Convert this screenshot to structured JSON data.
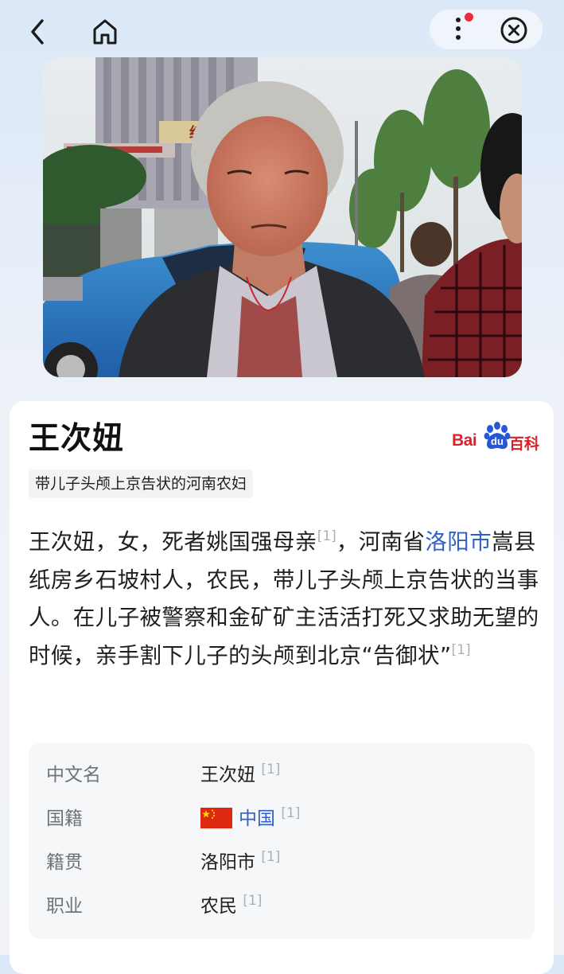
{
  "topbar": {
    "back_icon": "back-arrow-icon",
    "home_icon": "home-icon",
    "more_icon": "more-vertical-icon",
    "close_icon": "close-circle-icon",
    "notification_dot_color": "#f0283c"
  },
  "photo": {
    "description_icon": "portrait-photo",
    "sign_text": "红"
  },
  "entry": {
    "title": "王次妞",
    "tag": "带儿子头颅上京告状的河南农妇",
    "source_logo": {
      "bai": "Bai",
      "du": "du",
      "ke": "百科",
      "color": "#de1f28"
    },
    "summary": {
      "part1": "王次妞，女，死者姚国强母亲",
      "ref1": "[1]",
      "part2": "，河南省",
      "link": "洛阳市",
      "part3": "嵩县纸房乡石坡村人，农民，带儿子头颅上京告状的当事人。在儿子被警察和金矿矿主活活打死又求助无望的时候，亲手割下儿子的头颅到北京“告御状”",
      "ref2": "[1]"
    },
    "infobox": [
      {
        "label": "中文名",
        "value": "王次妞",
        "ref": "[1]"
      },
      {
        "label": "国籍",
        "value": "中国",
        "ref": "[1]",
        "flag": "china-flag-icon"
      },
      {
        "label": "籍贯",
        "value": "洛阳市",
        "ref": "[1]"
      },
      {
        "label": "职业",
        "value": "农民",
        "ref": "[1]"
      }
    ],
    "link_color": "#2f5fcb"
  }
}
